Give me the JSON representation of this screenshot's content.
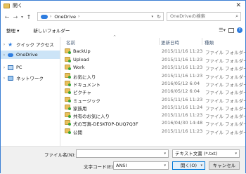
{
  "window": {
    "title": "開く",
    "close_glyph": "✕"
  },
  "nav": {
    "back": "←",
    "forward": "→",
    "history": "▾",
    "up": "↑",
    "path": "OneDrive",
    "path_sep": "›",
    "refresh": "↻",
    "search_placeholder": "OneDriveの検索",
    "search_icon": "magnifier-icon"
  },
  "toolbar": {
    "organize": "整理 ▾",
    "new_folder": "新しいフォルダー",
    "help": "?"
  },
  "sidebar": {
    "items": [
      {
        "label": "クイック アクセス",
        "icon": "star-icon"
      },
      {
        "label": "OneDrive",
        "icon": "cloud-icon",
        "selected": true
      },
      {
        "label": "PC",
        "icon": "computer-icon"
      },
      {
        "label": "ネットワーク",
        "icon": "network-icon"
      }
    ]
  },
  "list": {
    "columns": {
      "name": "名前",
      "date": "更新日時",
      "type": "種類"
    },
    "rows": [
      {
        "name": "BackUp",
        "date": "2015/11/16 11:23",
        "type": "ファイル フォルダー"
      },
      {
        "name": "Upload",
        "date": "2015/11/16 11:23",
        "type": "ファイル フォルダー"
      },
      {
        "name": "Work",
        "date": "2015/11/16 11:23",
        "type": "ファイル フォルダー"
      },
      {
        "name": "お気に入り",
        "date": "2015/11/16 11:23",
        "type": "ファイル フォルダー"
      },
      {
        "name": "ドキュメント",
        "date": "2016/05/12 6:04",
        "type": "ファイル フォルダー"
      },
      {
        "name": "ピクチャ",
        "date": "2016/05/12 6:04",
        "type": "ファイル フォルダー"
      },
      {
        "name": "ミュージック",
        "date": "2015/11/16 11:23",
        "type": "ファイル フォルダー"
      },
      {
        "name": "家族用",
        "date": "2015/11/16 11:24",
        "type": "ファイル フォルダー"
      },
      {
        "name": "共有のお気に入り",
        "date": "2015/11/16 11:23",
        "type": "ファイル フォルダー"
      },
      {
        "name": "犬の写真-DESKTOP-DUQ7Q3F",
        "date": "2016/04/30 14:48",
        "type": "ファイル フォルダー"
      },
      {
        "name": "公開",
        "date": "2015/11/16 11:23",
        "type": "ファイル フォルダー"
      }
    ]
  },
  "footer": {
    "filename_label": "ファイル名(N):",
    "filename_value": "",
    "filetype_value": "テキスト文書 (*.txt)",
    "encoding_label": "文字コード(E):",
    "encoding_value": "ANSI",
    "open_label": "開く(O)",
    "cancel_label": "キャンセル"
  }
}
